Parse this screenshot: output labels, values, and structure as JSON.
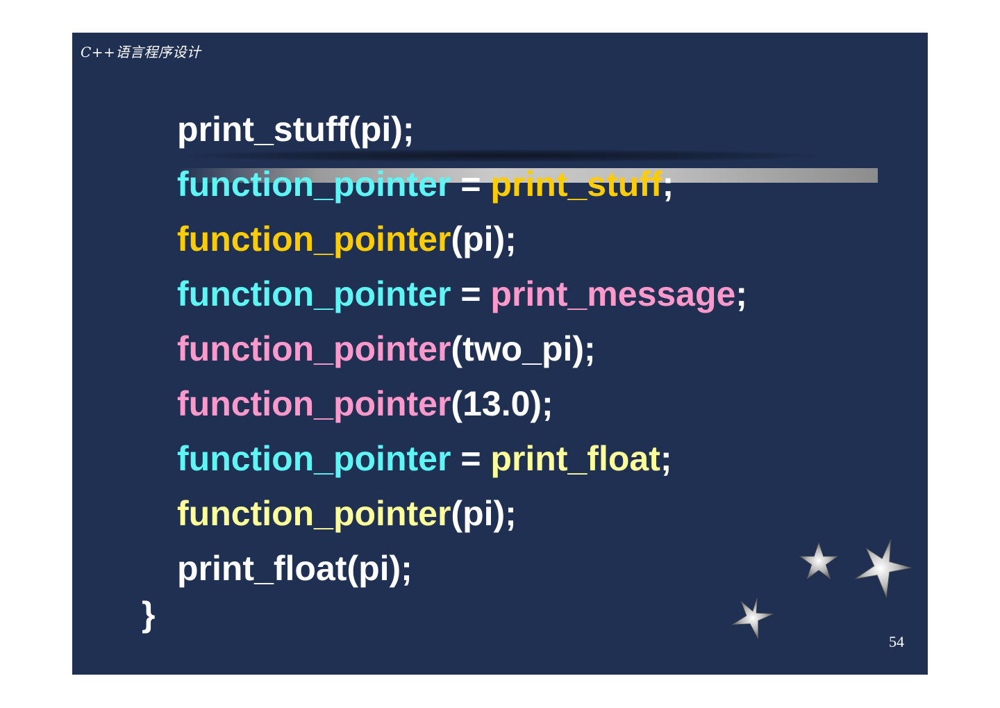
{
  "header": {
    "course_title": "C++语言程序设计"
  },
  "code_lines": [
    {
      "parts": [
        {
          "text": "print_stuff(pi);",
          "color": "white"
        }
      ]
    },
    {
      "parts": [
        {
          "text": "function_pointer",
          "color": "cyan"
        },
        {
          "text": " = ",
          "color": "white"
        },
        {
          "text": "print_stuff",
          "color": "orange"
        },
        {
          "text": ";",
          "color": "white"
        }
      ]
    },
    {
      "parts": [
        {
          "text": "function_pointer",
          "color": "orange"
        },
        {
          "text": "(pi);",
          "color": "white"
        }
      ]
    },
    {
      "parts": [
        {
          "text": "function_pointer",
          "color": "cyan"
        },
        {
          "text": " = ",
          "color": "white"
        },
        {
          "text": "print_message",
          "color": "pink"
        },
        {
          "text": ";",
          "color": "white"
        }
      ]
    },
    {
      "parts": [
        {
          "text": "function_pointer",
          "color": "pink"
        },
        {
          "text": "(two_pi);",
          "color": "white"
        }
      ]
    },
    {
      "parts": [
        {
          "text": "function_pointer",
          "color": "pink"
        },
        {
          "text": "(13.0);",
          "color": "white"
        }
      ]
    },
    {
      "parts": [
        {
          "text": "function_pointer",
          "color": "cyan"
        },
        {
          "text": " = ",
          "color": "white"
        },
        {
          "text": "print_float",
          "color": "yellow"
        },
        {
          "text": ";",
          "color": "white"
        }
      ]
    },
    {
      "parts": [
        {
          "text": "function_pointer",
          "color": "yellow"
        },
        {
          "text": "(pi);",
          "color": "white"
        }
      ]
    },
    {
      "parts": [
        {
          "text": "print_float(pi);",
          "color": "white"
        }
      ]
    }
  ],
  "closing_brace": "}",
  "page_number": "54",
  "colors": {
    "background": "#203052",
    "cyan": "#5ef5f5",
    "orange": "#ffcc00",
    "pink": "#ff99cc",
    "yellow": "#ffff99",
    "white": "#ffffff"
  },
  "decorations": {
    "star_icons": [
      "star-icon",
      "star-icon",
      "star-icon"
    ]
  }
}
